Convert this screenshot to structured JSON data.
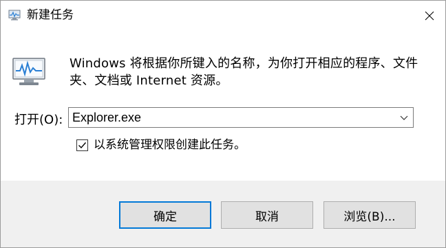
{
  "window": {
    "title": "新建任务"
  },
  "description": {
    "line1": "Windows 将根据你所键入的名称，为你打开相应的程序、文件",
    "line2": "夹、文档或 Internet 资源。"
  },
  "open_field": {
    "label": "打开(O):",
    "value": "Explorer.exe"
  },
  "admin_checkbox": {
    "label": "以系统管理权限创建此任务。",
    "checked": true
  },
  "buttons": {
    "ok": "确定",
    "cancel": "取消",
    "browse": "浏览(B)..."
  },
  "icons": {
    "title": "task-manager-icon",
    "main": "task-manager-monitor-icon",
    "close": "close-icon",
    "dropdown": "chevron-down-icon",
    "check": "checkmark-icon"
  },
  "colors": {
    "accent": "#0078d7",
    "footer": "#f0f0f0",
    "button": "#e1e1e1"
  }
}
